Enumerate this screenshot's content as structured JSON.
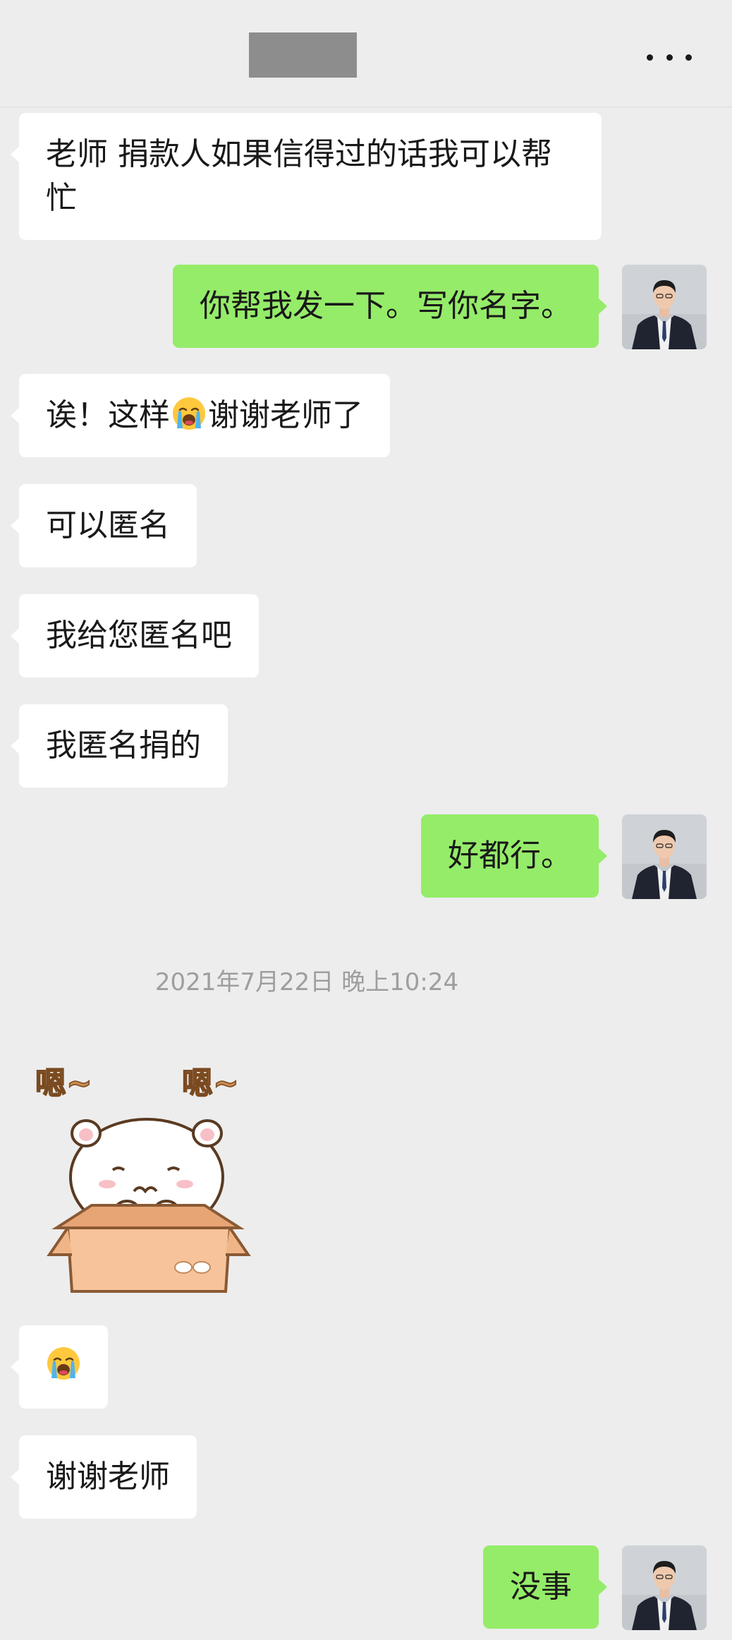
{
  "header": {
    "title_redacted": true,
    "more_icon": "more-horizontal-icon"
  },
  "messages": [
    {
      "side": "in",
      "text": "老师 捐款人如果信得过的话我可以帮忙"
    },
    {
      "side": "out",
      "text": "你帮我发一下。写你名字。"
    },
    {
      "side": "in",
      "text_before": "诶！这样",
      "emoji": "loudly-crying-face",
      "text_after": "谢谢老师了"
    },
    {
      "side": "in",
      "text": "可以匿名"
    },
    {
      "side": "in",
      "text": "我给您匿名吧"
    },
    {
      "side": "in",
      "text": "我匿名捐的"
    },
    {
      "side": "out",
      "text": "好都行。"
    },
    {
      "side": "in",
      "sticker": "cat-in-box-nodding",
      "sticker_text": [
        "嗯~",
        "嗯~"
      ]
    },
    {
      "side": "in",
      "emoji": "loudly-crying-face"
    },
    {
      "side": "in",
      "text": "谢谢老师"
    },
    {
      "side": "out",
      "text": "没事"
    }
  ],
  "timestamp": "2021年7月22日 晚上10:24",
  "colors": {
    "background": "#ededed",
    "incoming_bubble": "#ffffff",
    "outgoing_bubble": "#95ec69",
    "timestamp_text": "#9e9e9e"
  }
}
